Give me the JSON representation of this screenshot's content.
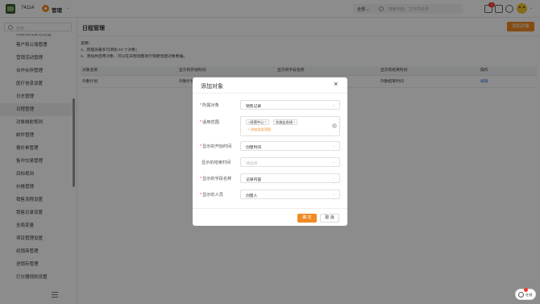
{
  "header": {
    "tenant_id": "74114",
    "app_menu": "管理",
    "search_scope": "全部",
    "search_placeholder": "搜索功能、工作项名称",
    "notification_count": "4",
    "icons": [
      "logo-icon",
      "manage-icon",
      "chevron-down-icon",
      "search-icon",
      "bell-icon",
      "mail-icon",
      "gear-icon",
      "avatar"
    ]
  },
  "sidebar": {
    "search_placeholder": "搜索",
    "items": [
      {
        "label": "线索和线索池设置"
      },
      {
        "label": "客户和公海管理"
      },
      {
        "label": "营销活动管理"
      },
      {
        "label": "合作伙伴管理"
      },
      {
        "label": "医疗信息设置"
      },
      {
        "label": "日志管理"
      },
      {
        "label": "日程管理"
      },
      {
        "label": "对象映射规则"
      },
      {
        "label": "邮件管理"
      },
      {
        "label": "报价单管理"
      },
      {
        "label": "售中交易管理"
      },
      {
        "label": "目标规则"
      },
      {
        "label": "价格管理"
      },
      {
        "label": "销售流程设置"
      },
      {
        "label": "销售记录设置"
      },
      {
        "label": "全局变量"
      },
      {
        "label": "项目管理设置"
      },
      {
        "label": "经销商管理"
      },
      {
        "label": "进销存管理"
      },
      {
        "label": "打分器规则设置"
      }
    ],
    "active_index": 6
  },
  "main": {
    "title": "日程管理",
    "add_button": "添加对象",
    "notes": [
      "说明：",
      "1、管理员最多可添加 10 个对象；",
      "2、添加并启用对象，可以在日程视图进行快捷创建对象数据。"
    ],
    "table": {
      "columns": [
        "对象名称",
        "显示的开始时间",
        "显示的字段名称",
        "显示的结束时间",
        "操作"
      ],
      "rows": [
        {
          "name": "外勤计划",
          "start": "外勤计划开始时间",
          "field": "外勤对象",
          "end": "外勤结束时间",
          "action": "编辑"
        }
      ]
    }
  },
  "modal": {
    "title": "添加对象",
    "fields": {
      "object": {
        "label": "所属对象",
        "value": "销售记录",
        "required": true
      },
      "scope": {
        "label": "适用范围",
        "required": true,
        "tags": [
          "经营中心",
          "实施业务线"
        ],
        "add_link": "+ 添加适用范围"
      },
      "start_time": {
        "label": "显示的开始时间",
        "value": "创建时间",
        "required": true
      },
      "end_time": {
        "label": "显示的结束时间",
        "placeholder": "请选择",
        "required": false
      },
      "field_name": {
        "label": "显示的字段名称",
        "value": "记录内容",
        "required": true
      },
      "person": {
        "label": "显示的人员",
        "value": "创建人",
        "required": true
      }
    },
    "confirm": "确 定",
    "cancel": "取 消"
  },
  "float_button": {
    "label": "在线"
  }
}
